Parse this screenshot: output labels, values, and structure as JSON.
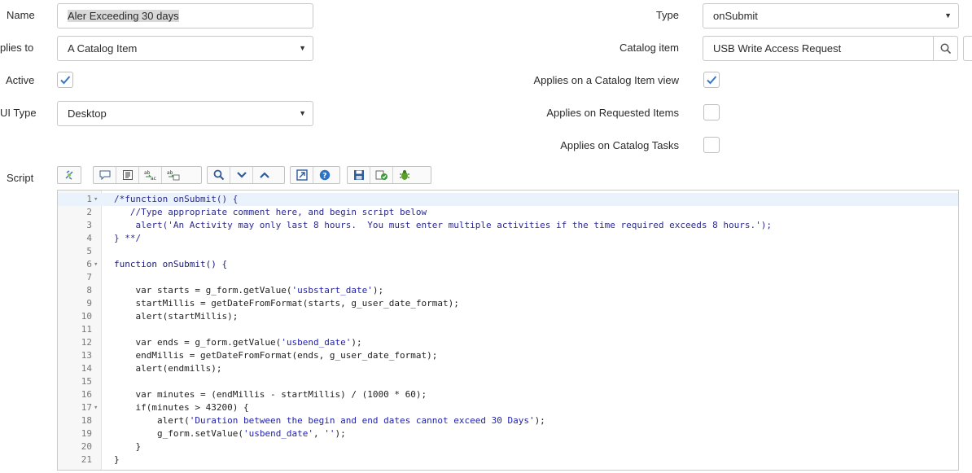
{
  "form": {
    "name_label": "Name",
    "name_value": "Aler Exceeding 30 days",
    "applies_to_label": "plies to",
    "applies_to_value": "A Catalog Item",
    "active_label": "Active",
    "active_checked": true,
    "ui_type_label": "UI Type",
    "ui_type_value": "Desktop",
    "type_label": "Type",
    "type_value": "onSubmit",
    "catalog_item_label": "Catalog item",
    "catalog_item_value": "USB Write Access Request",
    "applies_catalog_item_view_label": "Applies on a Catalog Item view",
    "applies_catalog_item_view_checked": true,
    "applies_requested_items_label": "Applies on Requested Items",
    "applies_requested_items_checked": false,
    "applies_catalog_tasks_label": "Applies on Catalog Tasks",
    "applies_catalog_tasks_checked": false,
    "script_label": "Script"
  },
  "toolbar": {
    "groups": [
      [
        "format-code-icon"
      ],
      [
        "comment-icon",
        "comment-block-icon",
        "replace-icon",
        "replace-all-icon"
      ],
      [
        "search-icon",
        "fold-down-icon",
        "fold-up-icon"
      ],
      [
        "fullscreen-icon",
        "help-icon"
      ],
      [
        "save-icon",
        "validate-icon",
        "debug-icon"
      ]
    ]
  },
  "accent_color": "#3b77c0",
  "script_lines": [
    {
      "n": "1",
      "fold": true,
      "code": "/*function onSubmit() {",
      "cls": "k-comment2"
    },
    {
      "n": "2",
      "fold": false,
      "code": "   //Type appropriate comment here, and begin script below",
      "cls": "k-comment2"
    },
    {
      "n": "3",
      "fold": false,
      "code": "    alert('An Activity may only last 8 hours.  You must enter multiple activities if the time required exceeds 8 hours.');",
      "cls": "k-comment2"
    },
    {
      "n": "4",
      "fold": false,
      "code": "} **/",
      "cls": "k-comment2"
    },
    {
      "n": "5",
      "fold": false,
      "code": "",
      "cls": ""
    },
    {
      "n": "6",
      "fold": true,
      "code": "function onSubmit() {",
      "cls": "k-kw"
    },
    {
      "n": "7",
      "fold": false,
      "code": "",
      "cls": ""
    },
    {
      "n": "8",
      "fold": false,
      "code": "    var starts = g_form.getValue('usbstart_date');",
      "cls": ""
    },
    {
      "n": "9",
      "fold": false,
      "code": "    startMillis = getDateFromFormat(starts, g_user_date_format);",
      "cls": ""
    },
    {
      "n": "10",
      "fold": false,
      "code": "    alert(startMillis);",
      "cls": ""
    },
    {
      "n": "11",
      "fold": false,
      "code": "",
      "cls": ""
    },
    {
      "n": "12",
      "fold": false,
      "code": "    var ends = g_form.getValue('usbend_date');",
      "cls": ""
    },
    {
      "n": "13",
      "fold": false,
      "code": "    endMillis = getDateFromFormat(ends, g_user_date_format);",
      "cls": ""
    },
    {
      "n": "14",
      "fold": false,
      "code": "    alert(endmills);",
      "cls": ""
    },
    {
      "n": "15",
      "fold": false,
      "code": "",
      "cls": ""
    },
    {
      "n": "16",
      "fold": false,
      "code": "    var minutes = (endMillis - startMillis) / (1000 * 60);",
      "cls": ""
    },
    {
      "n": "17",
      "fold": true,
      "code": "    if(minutes > 43200) {",
      "cls": ""
    },
    {
      "n": "18",
      "fold": false,
      "code": "        alert('Duration between the begin and end dates cannot exceed 30 Days');",
      "cls": ""
    },
    {
      "n": "19",
      "fold": false,
      "code": "        g_form.setValue('usbend_date', '');",
      "cls": ""
    },
    {
      "n": "20",
      "fold": false,
      "code": "    }",
      "cls": ""
    },
    {
      "n": "21",
      "fold": false,
      "code": "}",
      "cls": ""
    }
  ]
}
